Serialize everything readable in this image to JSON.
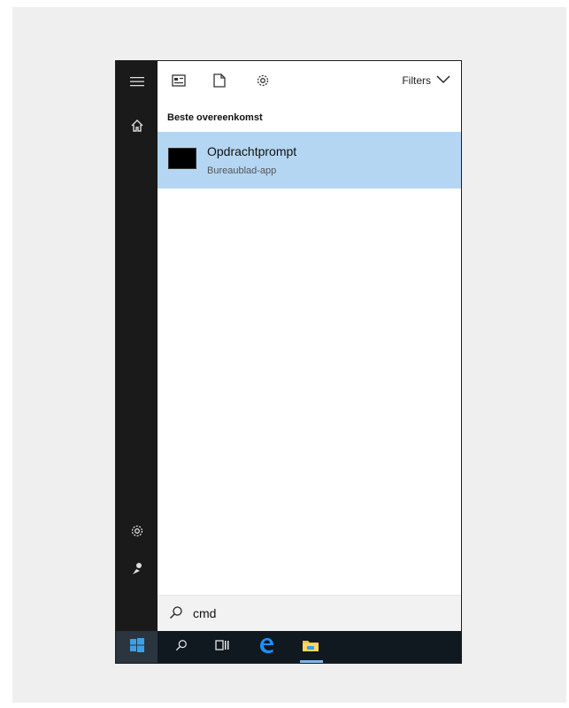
{
  "toolbar": {
    "filters_label": "Filters"
  },
  "section": {
    "best_match_label": "Beste overeenkomst"
  },
  "result": {
    "title": "Opdrachtprompt",
    "subtitle": "Bureaublad-app"
  },
  "search": {
    "query": "cmd"
  },
  "icons": {
    "hamburger": "hamburger-icon",
    "home": "home-icon",
    "settings": "gear-icon",
    "user": "user-icon",
    "apps": "apps-icon",
    "documents": "document-icon",
    "filters_chevron": "chevron-down-icon",
    "search": "search-icon",
    "start": "windows-logo-icon",
    "taskview": "task-view-icon",
    "edge": "edge-icon",
    "explorer": "file-explorer-icon"
  },
  "colors": {
    "rail": "#1a1a1a",
    "selected": "#b4d6f2",
    "taskbar": "#101820",
    "accent": "#0078d7"
  }
}
